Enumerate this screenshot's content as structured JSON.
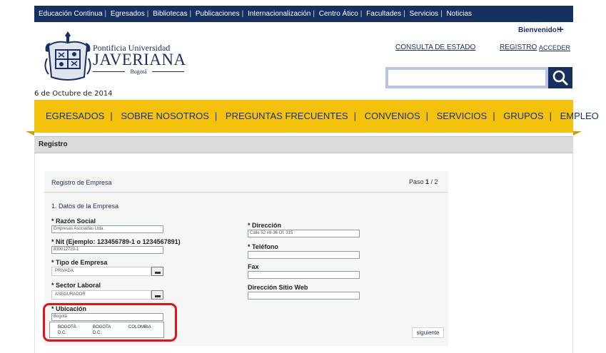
{
  "topnav": {
    "items": [
      "Educación Continua",
      "Egresados",
      "Bibliotecas",
      "Publicaciones",
      "Internacionalización",
      "Centro Ático",
      "Facultades",
      "Servicios",
      "Noticias"
    ],
    "separator": "|"
  },
  "logo": {
    "line1": "Pontificia Universidad",
    "line2": "JAVERIANA",
    "line3": "Bogotá"
  },
  "header": {
    "welcome": "Bienvenido!",
    "plus": "+",
    "consulta": "CONSULTA DE ESTADO",
    "registro": "REGISTRO",
    "acceder": "ACCEDER"
  },
  "search": {
    "value": "",
    "icon": "search-icon"
  },
  "date": "6 de Octubre de 2014",
  "mainnav": {
    "items": [
      "EGRESADOS",
      "SOBRE NOSOTROS",
      "PREGUNTAS FRECUENTES",
      "CONVENIOS",
      "SERVICIOS",
      "GRUPOS",
      "EMPLEO"
    ],
    "separator": "|"
  },
  "section": {
    "title": "Registro"
  },
  "form": {
    "title": "Registro de Empresa",
    "step_prefix": "Paso ",
    "step_current": "1",
    "step_rest": " / 2",
    "section_title": "1. Datos de la Empresa",
    "razon": {
      "label": "* Razón Social",
      "value": "Empresas Asociadas Ltda."
    },
    "nit": {
      "label": "* Nit (Ejemplo: 123456789-1 o 1234567891)",
      "value": "830012720-1"
    },
    "tipo": {
      "label": "* Tipo de Empresa",
      "value": "PRIVADA"
    },
    "sector": {
      "label": "* Sector Laboral",
      "value": "ASEGURADOR"
    },
    "ubicacion": {
      "label": "* Ubicación",
      "value": "Bogotá",
      "suggestion": {
        "col1": "BOGOTÁ D.C.",
        "col2": "BOGOTA D.C.",
        "col3": "COLOMBIA"
      }
    },
    "direccion": {
      "label": "* Dirección",
      "value": "Calle 52 #8-36 Of. 315"
    },
    "telefono": {
      "label": "* Teléfono",
      "value": ""
    },
    "fax": {
      "label": "Fax",
      "value": ""
    },
    "web": {
      "label": "Dirección Sitio Web",
      "value": ""
    },
    "next": "siguiente"
  },
  "colors": {
    "topbar": "#16315f",
    "nav_bg": "#f4c20d",
    "accent_text": "#16315f",
    "highlight": "#e0131b"
  }
}
